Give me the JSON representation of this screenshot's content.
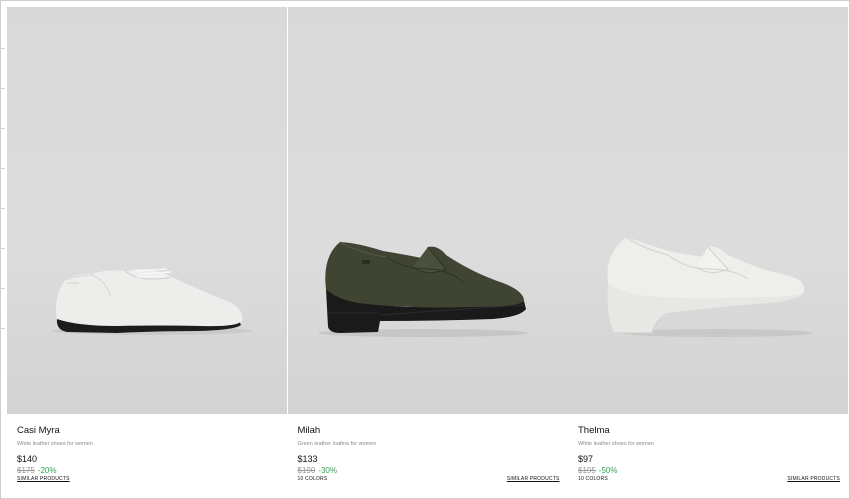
{
  "products": [
    {
      "name": "Casi Myra",
      "description": "White leather shoes for women",
      "price": "$140",
      "original_price": "$175",
      "discount": "-20%",
      "colors": "",
      "similar_label": "SIMILAR PRODUCTS",
      "image_icon": "white-oxford-shoe"
    },
    {
      "name": "Milah",
      "description": "Green leather loafers for women",
      "price": "$133",
      "original_price": "$190",
      "discount": "-30%",
      "colors": "10 COLORS",
      "similar_label": "SIMILAR PRODUCTS",
      "image_icon": "green-platform-loafer"
    },
    {
      "name": "Thelma",
      "description": "White leather shoes for women",
      "price": "$97",
      "original_price": "$195",
      "discount": "-50%",
      "colors": "10 COLORS",
      "similar_label": "SIMILAR PRODUCTS",
      "image_icon": "white-heeled-loafer"
    }
  ],
  "colors": {
    "discount": "#2fa84f",
    "photo_bg": "#dadadb"
  }
}
